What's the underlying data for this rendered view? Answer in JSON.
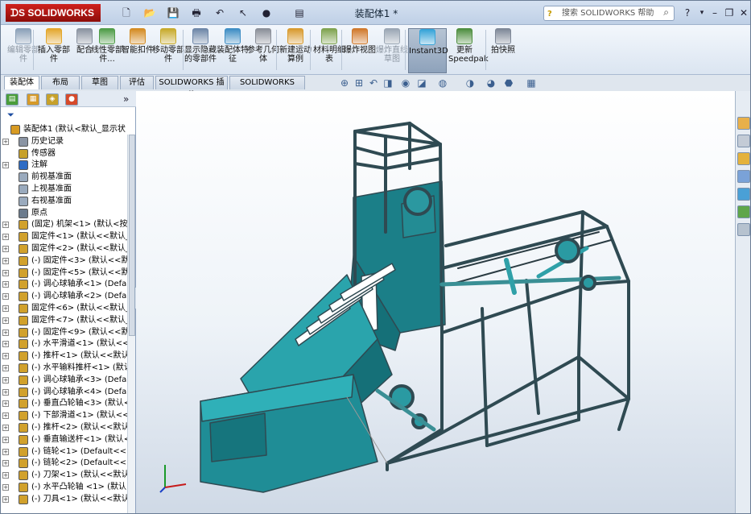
{
  "app": {
    "brand": "SOLIDWORKS",
    "window_title": "装配体1 *",
    "brand_color": "#cf1f1b"
  },
  "quick_access": [
    {
      "icon": "new-document-icon",
      "glyph": "🗋"
    },
    {
      "icon": "open-folder-icon",
      "glyph": "📂"
    },
    {
      "icon": "save-icon",
      "glyph": "💾"
    },
    {
      "icon": "print-icon",
      "glyph": "🖶"
    },
    {
      "icon": "undo-icon",
      "glyph": "↶"
    },
    {
      "icon": "select-arrow-icon",
      "glyph": "↖"
    },
    {
      "icon": "rebuild-traffic-light-icon",
      "glyph": "●"
    },
    {
      "icon": "file-properties-icon",
      "glyph": "▤"
    }
  ],
  "search": {
    "placeholder": "搜索 SOLIDWORKS 帮助"
  },
  "ribbon": [
    {
      "label": "编辑零部件",
      "disabled": true,
      "color": "#8aa0b8"
    },
    {
      "label": "插入零部件",
      "disabled": false,
      "color": "#e3a72c"
    },
    {
      "label": "配合",
      "disabled": false,
      "color": "#8a93a1"
    },
    {
      "label": "线性零部件...",
      "disabled": false,
      "color": "#4e9c47"
    },
    {
      "label": "智能扣件",
      "disabled": false,
      "color": "#d48b22"
    },
    {
      "label": "移动零部件",
      "disabled": false,
      "color": "#c7aa2a"
    },
    {
      "label": "显示隐藏的零部件",
      "disabled": false,
      "color": "#6d86a8"
    },
    {
      "label": "装配体特征",
      "disabled": false,
      "color": "#3e8dc4"
    },
    {
      "label": "参考几何体",
      "disabled": false,
      "color": "#8a8f99"
    },
    {
      "label": "新建运动算例",
      "disabled": false,
      "color": "#d89a2d"
    },
    {
      "label": "材料明细表",
      "disabled": false,
      "color": "#7ea34f"
    },
    {
      "label": "爆炸视图",
      "disabled": false,
      "color": "#d0782b"
    },
    {
      "label": "爆炸直线草图",
      "disabled": true,
      "color": "#9aa6b4"
    },
    {
      "label": "Instant3D",
      "disabled": false,
      "color": "#37a4d8",
      "selected": true
    },
    {
      "label": "更新Speedpak",
      "disabled": false,
      "color": "#4e8e3f"
    },
    {
      "label": "拍快照",
      "disabled": false,
      "color": "#7d8797"
    }
  ],
  "tabs": [
    {
      "label": "装配体",
      "active": true
    },
    {
      "label": "布局"
    },
    {
      "label": "草图"
    },
    {
      "label": "评估"
    },
    {
      "label": "SOLIDWORKS 插件"
    },
    {
      "label": "SOLIDWORKS MBD"
    }
  ],
  "view_toolbar": [
    "zoom-to-fit-icon",
    "zoom-area-icon",
    "previous-view-icon",
    "section-view-icon",
    "dynamic-annotation-icon",
    "view-orientation-icon",
    "display-style-icon",
    "hide-show-items-icon",
    "edit-appearance-icon",
    "apply-scene-icon",
    "view-settings-icon"
  ],
  "feature_tree": [
    {
      "label": "装配体1 (默认<默认_显示状",
      "icon": "assembly-icon",
      "indent": 0,
      "exp": ""
    },
    {
      "label": "历史记录",
      "icon": "history-icon",
      "indent": 1,
      "exp": "+"
    },
    {
      "label": "传感器",
      "icon": "sensor-icon",
      "indent": 1,
      "exp": ""
    },
    {
      "label": "注解",
      "icon": "annotation-icon",
      "indent": 1,
      "exp": "+"
    },
    {
      "label": "前视基准面",
      "icon": "plane-icon",
      "indent": 1,
      "exp": ""
    },
    {
      "label": "上视基准面",
      "icon": "plane-icon",
      "indent": 1,
      "exp": ""
    },
    {
      "label": "右视基准面",
      "icon": "plane-icon",
      "indent": 1,
      "exp": ""
    },
    {
      "label": "原点",
      "icon": "origin-icon",
      "indent": 1,
      "exp": ""
    },
    {
      "label": "(固定) 机架<1> (默认<按",
      "icon": "part-icon",
      "indent": 1,
      "exp": "+"
    },
    {
      "label": "固定件<1> (默认<<默认_",
      "icon": "part-icon",
      "indent": 1,
      "exp": "+"
    },
    {
      "label": "固定件<2> (默认<<默认_",
      "icon": "part-icon",
      "indent": 1,
      "exp": "+"
    },
    {
      "label": "(-) 固定件<3> (默认<<默",
      "icon": "part-icon",
      "indent": 1,
      "exp": "+"
    },
    {
      "label": "(-) 固定件<5> (默认<<默",
      "icon": "part-icon",
      "indent": 1,
      "exp": "+"
    },
    {
      "label": "(-) 调心球轴承<1> (Defa",
      "icon": "part-icon",
      "indent": 1,
      "exp": "+"
    },
    {
      "label": "(-) 调心球轴承<2> (Defa",
      "icon": "part-icon",
      "indent": 1,
      "exp": "+"
    },
    {
      "label": "固定件<6> (默认<<默认_",
      "icon": "part-icon",
      "indent": 1,
      "exp": "+"
    },
    {
      "label": "固定件<7> (默认<<默认_",
      "icon": "part-icon",
      "indent": 1,
      "exp": "+"
    },
    {
      "label": "(-) 固定件<9> (默认<<默",
      "icon": "part-icon",
      "indent": 1,
      "exp": "+"
    },
    {
      "label": "(-) 水平滑道<1> (默认<<",
      "icon": "part-icon",
      "indent": 1,
      "exp": "+"
    },
    {
      "label": "(-) 推杆<1> (默认<<默认",
      "icon": "part-icon",
      "indent": 1,
      "exp": "+"
    },
    {
      "label": "(-) 水平输料推杆<1> (默认",
      "icon": "part-icon",
      "indent": 1,
      "exp": "+"
    },
    {
      "label": "(-) 调心球轴承<3> (Defa",
      "icon": "part-icon",
      "indent": 1,
      "exp": "+"
    },
    {
      "label": "(-) 调心球轴承<4> (Defa",
      "icon": "part-icon",
      "indent": 1,
      "exp": "+"
    },
    {
      "label": "(-) 垂直凸轮轴<3> (默认<",
      "icon": "part-icon",
      "indent": 1,
      "exp": "+"
    },
    {
      "label": "(-) 下部滑道<1> (默认<<",
      "icon": "part-icon",
      "indent": 1,
      "exp": "+"
    },
    {
      "label": "(-) 推杆<2> (默认<<默认",
      "icon": "part-icon",
      "indent": 1,
      "exp": "+"
    },
    {
      "label": "(-) 垂直输送杆<1> (默认<",
      "icon": "part-icon",
      "indent": 1,
      "exp": "+"
    },
    {
      "label": "(-) 链轮<1> (Default<<D",
      "icon": "part-icon",
      "indent": 1,
      "exp": "+"
    },
    {
      "label": "(-) 链轮<2> (Default<<D",
      "icon": "part-icon",
      "indent": 1,
      "exp": "+"
    },
    {
      "label": "(-) 刀架<1> (默认<<默认",
      "icon": "part-icon",
      "indent": 1,
      "exp": "+"
    },
    {
      "label": "(-) 水平凸轮轴 <1> (默认",
      "icon": "part-icon",
      "indent": 1,
      "exp": "+"
    },
    {
      "label": "(-) 刀具<1> (默认<<默认",
      "icon": "part-icon",
      "indent": 1,
      "exp": "+"
    }
  ],
  "model": {
    "frame_color": "#2f4a52",
    "body_color": "#1e8a93",
    "dark_color": "#13636b",
    "motor_color": "#257f87"
  }
}
